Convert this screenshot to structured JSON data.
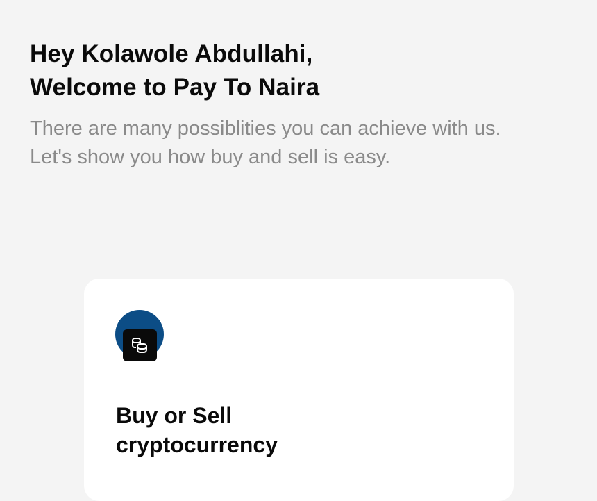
{
  "header": {
    "greeting_line1": "Hey Kolawole Abdullahi,",
    "greeting_line2": "Welcome to Pay To Naira",
    "intro": "There are many possiblities you can achieve with us. Let's show you how buy and sell is easy."
  },
  "cards": [
    {
      "icon": "coins-icon",
      "title_line1": "Buy or Sell",
      "title_line2": "cryptocurrency"
    }
  ],
  "colors": {
    "background": "#f4f4f4",
    "card": "#ffffff",
    "icon_circle": "#0c4d86",
    "heading": "#0a0a0a",
    "muted_text": "#8a8a8a"
  }
}
